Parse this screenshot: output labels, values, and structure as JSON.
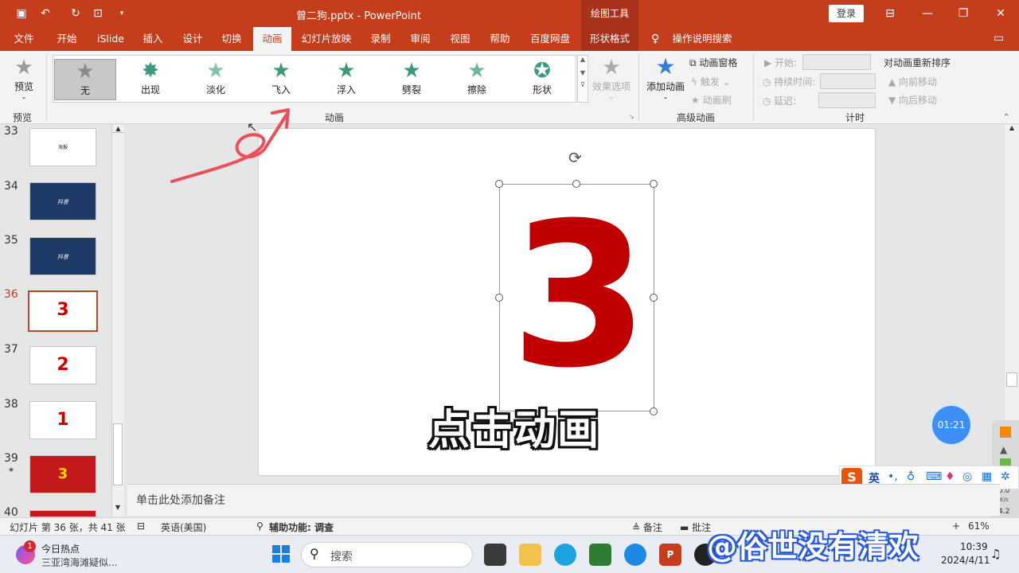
{
  "window": {
    "title": "曾二狗.pptx - PowerPoint",
    "contextual_group": "绘图工具",
    "login_label": "登录"
  },
  "tabs": [
    "文件",
    "开始",
    "iSlide",
    "插入",
    "设计",
    "切换",
    "动画",
    "幻灯片放映",
    "录制",
    "审阅",
    "视图",
    "帮助",
    "百度网盘",
    "形状格式",
    "操作说明搜索"
  ],
  "active_tab": "动画",
  "ribbon": {
    "preview_label": "预览",
    "preview_group": "预览",
    "animation_group": "动画",
    "animations": [
      "无",
      "出现",
      "淡化",
      "飞入",
      "浮入",
      "劈裂",
      "擦除",
      "形状"
    ],
    "effect_options": "效果选项",
    "advanced_group": "高级动画",
    "add_animation": "添加动画",
    "animation_pane": "动画窗格",
    "trigger": "触发",
    "animation_painter": "动画刷",
    "timing_group": "计时",
    "start_label": "开始:",
    "duration_label": "持续时间:",
    "delay_label": "延迟:",
    "reorder_label": "对动画重新排序",
    "move_earlier": "向前移动",
    "move_later": "向后移动"
  },
  "slides": [
    {
      "num": "33",
      "text": "海报"
    },
    {
      "num": "34",
      "text": "抖音"
    },
    {
      "num": "35",
      "text": "抖音"
    },
    {
      "num": "36",
      "text": "3"
    },
    {
      "num": "37",
      "text": "2"
    },
    {
      "num": "38",
      "text": "1"
    },
    {
      "num": "39",
      "text": "3"
    },
    {
      "num": "40",
      "text": ""
    }
  ],
  "current_slide": "36",
  "slide_content": {
    "big_number": "3",
    "caption": "点击动画"
  },
  "timer": "01:21",
  "notes_placeholder": "单击此处添加备注",
  "status": {
    "slide_info": "幻灯片 第 36 张，共 41 张",
    "language": "英语(美国)",
    "accessibility": "辅助功能: 调查",
    "notes": "备注",
    "comments": "批注",
    "zoom": "61%"
  },
  "ime": {
    "lang": "英",
    "speed_up": "0.0",
    "speed_down": "4.2",
    "unit": "K/s"
  },
  "taskbar": {
    "news_title": "今日热点",
    "news_sub": "三亚湾海滩疑似...",
    "news_badge": "1",
    "search_placeholder": "搜索",
    "time": "10:39",
    "date": "2024/4/11"
  },
  "watermark": "@俗世没有清欢",
  "colors": {
    "accent": "#c43e1c",
    "slide_number": "#c00000"
  }
}
